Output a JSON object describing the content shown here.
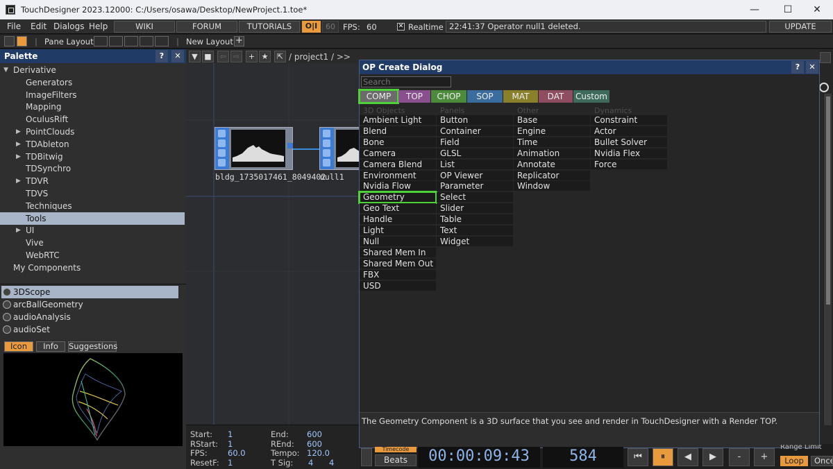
{
  "window": {
    "title": "TouchDesigner 2023.12000: C:/Users/osawa/Desktop/NewProject.1.toe*",
    "minimize": "—",
    "maximize": "☐",
    "close": "✕"
  },
  "menu": {
    "items": [
      "File",
      "Edit",
      "Dialogs",
      "Help"
    ],
    "links": [
      "WIKI",
      "FORUM",
      "TUTORIALS"
    ],
    "oi_label": "O|I",
    "fps_disabled": "60",
    "fps_label": "FPS:",
    "fps_value": "60",
    "realtime_check": "✕",
    "realtime_label": "Realtime",
    "status": "22:41:37 Operator null1 deleted.",
    "update": "UPDATE"
  },
  "toolbar": {
    "pane_layout": "Pane Layout",
    "new_layout": "New Layout",
    "add": "+"
  },
  "palette": {
    "title": "Palette",
    "help": "?",
    "close": "✕",
    "tree": [
      {
        "label": "Derivative",
        "level": 0,
        "expanded": true
      },
      {
        "label": "Generators",
        "level": 1
      },
      {
        "label": "ImageFilters",
        "level": 1
      },
      {
        "label": "Mapping",
        "level": 1
      },
      {
        "label": "OculusRift",
        "level": 1
      },
      {
        "label": "PointClouds",
        "level": 1,
        "collapsed": true
      },
      {
        "label": "TDAbleton",
        "level": 1,
        "collapsed": true
      },
      {
        "label": "TDBitwig",
        "level": 1,
        "collapsed": true
      },
      {
        "label": "TDSynchro",
        "level": 1
      },
      {
        "label": "TDVR",
        "level": 1,
        "collapsed": true
      },
      {
        "label": "TDVS",
        "level": 1
      },
      {
        "label": "Techniques",
        "level": 1
      },
      {
        "label": "Tools",
        "level": 1,
        "selected": true
      },
      {
        "label": "UI",
        "level": 1,
        "collapsed": true
      },
      {
        "label": "Vive",
        "level": 1
      },
      {
        "label": "WebRTC",
        "level": 1
      },
      {
        "label": "My Components",
        "level": 0
      }
    ],
    "components": [
      {
        "label": "3DScope",
        "selected": true
      },
      {
        "label": "arcBallGeometry"
      },
      {
        "label": "audioAnalysis"
      },
      {
        "label": "audioSet"
      }
    ],
    "preview_tabs": [
      {
        "label": "Icon",
        "active": true
      },
      {
        "label": "Info"
      },
      {
        "label": "Suggestions"
      }
    ]
  },
  "network": {
    "path": "/ project1 / >>",
    "nodes": [
      {
        "label": "bldg_1735017461_8049402"
      },
      {
        "label": "null1"
      }
    ]
  },
  "timebar": {
    "rows": [
      {
        "l1": "Start:",
        "v1": "1",
        "l2": "End:",
        "v2": "600"
      },
      {
        "l1": "RStart:",
        "v1": "1",
        "l2": "REnd:",
        "v2": "600"
      },
      {
        "l1": "FPS:",
        "v1": "60.0",
        "l2": "Tempo:",
        "v2": "120.0"
      },
      {
        "l1": "ResetF:",
        "v1": "1",
        "l2": "T Sig:",
        "v2": "4",
        "v3": "4"
      }
    ]
  },
  "transport": {
    "timecode_tab": "Timecode",
    "beats": "Beats",
    "time": "00:00:09:43",
    "frame": "584",
    "range_limit": "Range Limit",
    "loop": "Loop",
    "once": "Once",
    "plus": "+",
    "minus": "-"
  },
  "dialog": {
    "title": "OP Create Dialog",
    "help": "?",
    "close": "✕",
    "search_placeholder": "Search",
    "tabs": [
      {
        "label": "COMP",
        "color": "#6b6b6b",
        "highlight": true
      },
      {
        "label": "TOP",
        "color": "#8a4f8f"
      },
      {
        "label": "CHOP",
        "color": "#4b8b3b"
      },
      {
        "label": "SOP",
        "color": "#3a6d9e"
      },
      {
        "label": "MAT",
        "color": "#8a7f2a"
      },
      {
        "label": "DAT",
        "color": "#8f4d62"
      },
      {
        "label": "Custom",
        "color": "#3d6a5a"
      }
    ],
    "columns": [
      {
        "header": "3D Objects",
        "items": [
          "Ambient Light",
          "Blend",
          "Bone",
          "Camera",
          "Camera Blend",
          "Environment Light",
          "Nvidia Flow Emitter",
          "Geometry",
          "Geo Text",
          "Handle",
          "Light",
          "Null",
          "Shared Mem In",
          "Shared Mem Out",
          "FBX",
          "USD"
        ],
        "highlight": "Geometry"
      },
      {
        "header": "Panels",
        "items": [
          "Button",
          "Container",
          "Field",
          "GLSL",
          "List",
          "OP Viewer",
          "Parameter",
          "Select",
          "Slider",
          "Table",
          "Text",
          "Widget"
        ]
      },
      {
        "header": "Other",
        "items": [
          "Base",
          "Engine",
          "Time",
          "Animation",
          "Annotate",
          "Replicator",
          "Window"
        ]
      },
      {
        "header": "Dynamics",
        "items": [
          "Constraint",
          "Actor",
          "Bullet Solver",
          "Nvidia Flex Solver",
          "Force"
        ]
      }
    ],
    "description": "The Geometry Component is a 3D surface that you see and render in TouchDesigner with a Render TOP."
  },
  "colors": {
    "accent_orange": "#e89a3c",
    "highlight_green": "#4fd13a",
    "header_blue": "#1f3b66",
    "node_blue": "#3c7bd4"
  }
}
